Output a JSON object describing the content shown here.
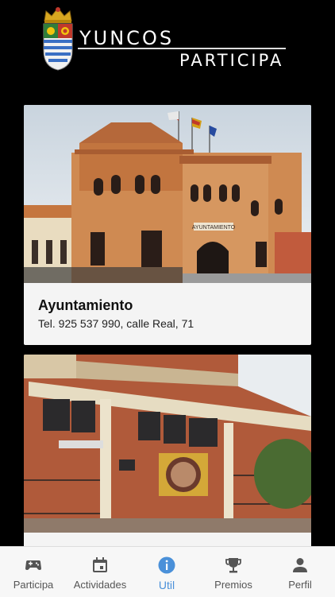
{
  "header": {
    "brand_line1": "YUNCOS",
    "brand_line2": "PARTICIPA"
  },
  "cards": [
    {
      "title": "Ayuntamiento",
      "subtitle": "Tel. 925 537 990, calle Real, 71",
      "image_sign": "AYUNTAMIENTO"
    },
    {
      "title": "",
      "subtitle": ""
    }
  ],
  "bottom_nav": {
    "items": [
      {
        "label": "Participa",
        "icon": "gamepad-icon"
      },
      {
        "label": "Actividades",
        "icon": "calendar-icon"
      },
      {
        "label": "Util",
        "icon": "info-icon",
        "active": true
      },
      {
        "label": "Premios",
        "icon": "trophy-icon"
      },
      {
        "label": "Perfil",
        "icon": "person-icon"
      }
    ]
  },
  "colors": {
    "background": "#000000",
    "active": "#4a90d9",
    "nav_background": "#f7f7f7",
    "card_background": "#f4f4f4"
  }
}
